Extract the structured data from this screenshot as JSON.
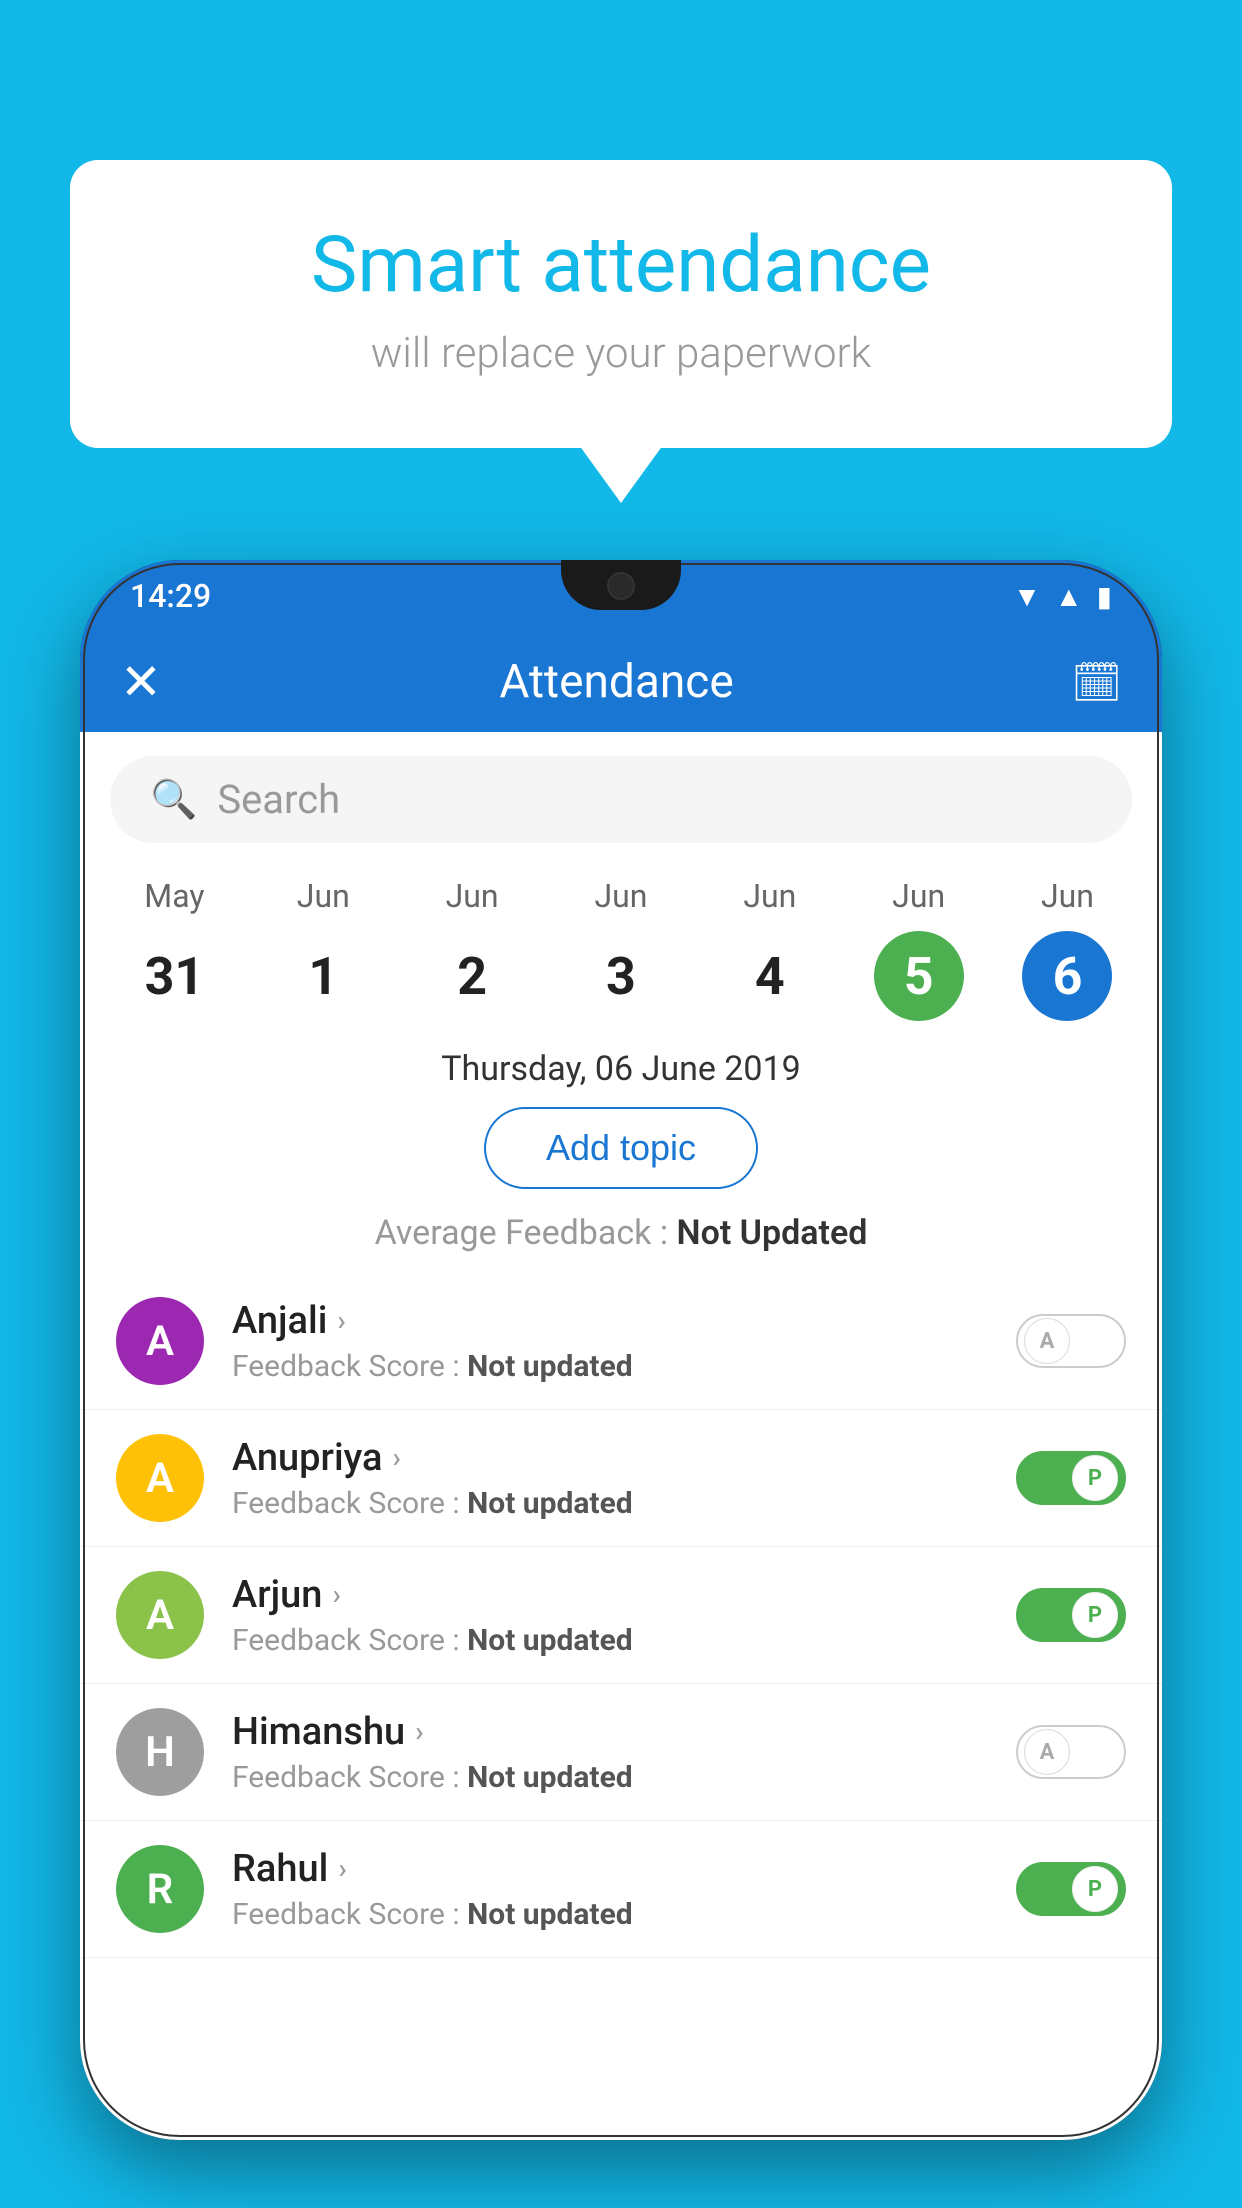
{
  "background": "#12B8E8",
  "bubble": {
    "title": "Smart attendance",
    "subtitle": "will replace your paperwork"
  },
  "statusBar": {
    "time": "14:29",
    "icons": [
      "▲",
      "▲",
      "▮"
    ]
  },
  "header": {
    "title": "Attendance",
    "close_label": "✕",
    "calendar_icon": "📅"
  },
  "search": {
    "placeholder": "Search"
  },
  "calendar": {
    "days": [
      {
        "month": "May",
        "num": "31",
        "state": "normal"
      },
      {
        "month": "Jun",
        "num": "1",
        "state": "normal"
      },
      {
        "month": "Jun",
        "num": "2",
        "state": "normal"
      },
      {
        "month": "Jun",
        "num": "3",
        "state": "normal"
      },
      {
        "month": "Jun",
        "num": "4",
        "state": "normal"
      },
      {
        "month": "Jun",
        "num": "5",
        "state": "today"
      },
      {
        "month": "Jun",
        "num": "6",
        "state": "selected"
      }
    ]
  },
  "dateLabel": "Thursday, 06 June 2019",
  "addTopic": "Add topic",
  "avgFeedback": {
    "label": "Average Feedback : ",
    "value": "Not Updated"
  },
  "students": [
    {
      "name": "Anjali",
      "avatarColor": "#9C27B0",
      "avatarLetter": "A",
      "feedbackLabel": "Feedback Score : ",
      "feedbackValue": "Not updated",
      "toggleState": "off",
      "toggleLabel": "A"
    },
    {
      "name": "Anupriya",
      "avatarColor": "#FFC107",
      "avatarLetter": "A",
      "feedbackLabel": "Feedback Score : ",
      "feedbackValue": "Not updated",
      "toggleState": "on",
      "toggleLabel": "P"
    },
    {
      "name": "Arjun",
      "avatarColor": "#8BC34A",
      "avatarLetter": "A",
      "feedbackLabel": "Feedback Score : ",
      "feedbackValue": "Not updated",
      "toggleState": "on",
      "toggleLabel": "P"
    },
    {
      "name": "Himanshu",
      "avatarColor": "#9E9E9E",
      "avatarLetter": "H",
      "feedbackLabel": "Feedback Score : ",
      "feedbackValue": "Not updated",
      "toggleState": "off",
      "toggleLabel": "A"
    },
    {
      "name": "Rahul",
      "avatarColor": "#4CAF50",
      "avatarLetter": "R",
      "feedbackLabel": "Feedback Score : ",
      "feedbackValue": "Not updated",
      "toggleState": "on",
      "toggleLabel": "P"
    }
  ]
}
